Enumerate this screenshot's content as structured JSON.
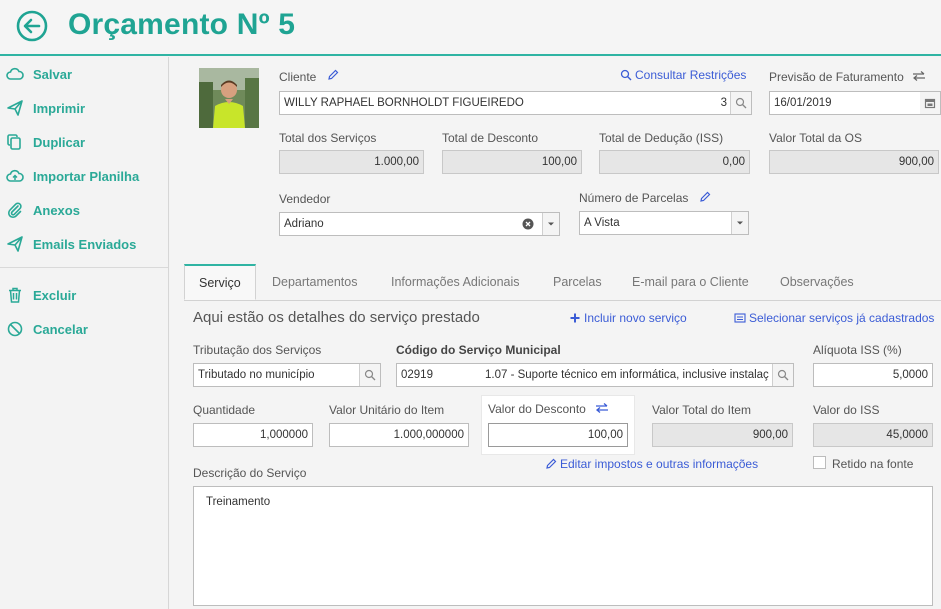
{
  "header": {
    "title": "Orçamento Nº 5",
    "back_icon": "back-arrow-circle-icon",
    "accent": "#1fa493"
  },
  "sidebar": {
    "items": [
      {
        "label": "Salvar",
        "icon": "cloud-icon"
      },
      {
        "label": "Imprimir",
        "icon": "send-icon"
      },
      {
        "label": "Duplicar",
        "icon": "copy-icon"
      },
      {
        "label": "Importar Planilha",
        "icon": "cloud-upload-icon"
      },
      {
        "label": "Anexos",
        "icon": "paperclip-icon"
      },
      {
        "label": "Emails Enviados",
        "icon": "send-icon"
      },
      {
        "label": "Excluir",
        "icon": "trash-icon"
      },
      {
        "label": "Cancelar",
        "icon": "ban-icon"
      }
    ]
  },
  "client": {
    "label": "Cliente",
    "value": "WILLY RAPHAEL BORNHOLDT FIGUEIREDO",
    "value_suffix": "3",
    "consult_link": "Consultar Restrições"
  },
  "billing": {
    "label": "Previsão de Faturamento",
    "value": "16/01/2019"
  },
  "totals": {
    "services_label": "Total dos Serviços",
    "services_value": "1.000,00",
    "discount_label": "Total de Desconto",
    "discount_value": "100,00",
    "deduction_label": "Total de Dedução (ISS)",
    "deduction_value": "0,00",
    "os_label": "Valor Total da OS",
    "os_value": "900,00"
  },
  "seller": {
    "label": "Vendedor",
    "value": "Adriano"
  },
  "installments": {
    "label": "Número de Parcelas",
    "value": "A Vista"
  },
  "tabs": [
    "Serviço",
    "Departamentos",
    "Informações Adicionais",
    "Parcelas",
    "E-mail para o Cliente",
    "Observações"
  ],
  "service": {
    "section_title": "Aqui estão os detalhes do serviço prestado",
    "add_link": "Incluir novo serviço",
    "select_link": "Selecionar serviços já cadastrados",
    "taxation_label": "Tributação dos Serviços",
    "taxation_value": "Tributado no município",
    "municipal_code_label": "Código do Serviço Municipal",
    "municipal_code_value": "02919",
    "municipal_desc_value": "1.07 - Suporte técnico em informática, inclusive instalaç",
    "iss_rate_label": "Alíquota ISS (%)",
    "iss_rate_value": "5,0000",
    "quantity_label": "Quantidade",
    "quantity_value": "1,000000",
    "unit_value_label": "Valor Unitário do Item",
    "unit_value_value": "1.000,000000",
    "discount_label": "Valor do Desconto",
    "discount_value": "100,00",
    "item_total_label": "Valor Total do Item",
    "item_total_value": "900,00",
    "iss_value_label": "Valor do ISS",
    "iss_value_value": "45,0000",
    "edit_taxes_link": "Editar impostos e outras informações",
    "withheld_label": "Retido na fonte",
    "withheld_checked": false,
    "description_label": "Descrição do Serviço",
    "description_value": "Treinamento"
  }
}
